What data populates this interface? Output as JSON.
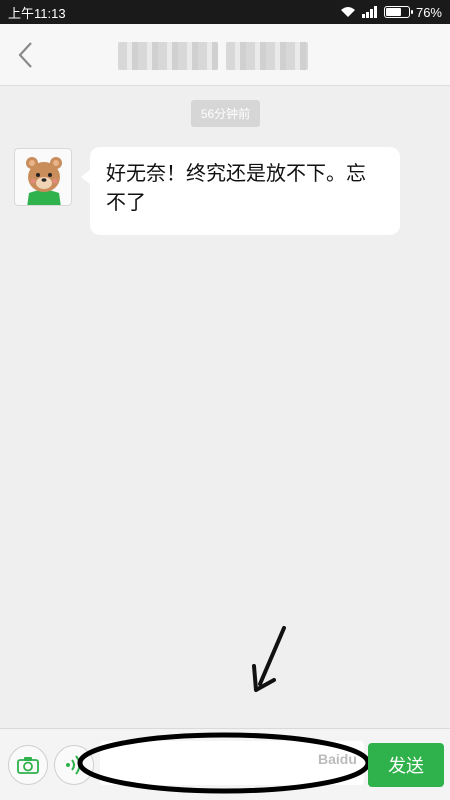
{
  "status_bar": {
    "time": "上午11:13",
    "battery": "76%",
    "battery_level": 0.76
  },
  "header": {
    "back_icon": "chevron-left-icon"
  },
  "chat": {
    "timestamp": "56分钟前",
    "message": {
      "text": "好无奈！终究还是放不下。忘不了"
    }
  },
  "input_bar": {
    "send_label": "发送",
    "watermark": "Baidu"
  },
  "colors": {
    "send_green": "#2fb24c",
    "bubble": "#ffffff",
    "background": "#efefef"
  }
}
